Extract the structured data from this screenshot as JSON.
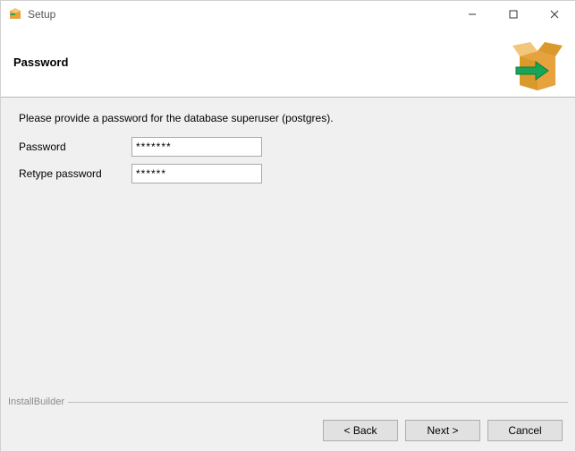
{
  "titlebar": {
    "title": "Setup"
  },
  "header": {
    "page_title": "Password"
  },
  "body": {
    "description": "Please provide a password for the database superuser (postgres).",
    "fields": {
      "password_label": "Password",
      "password_value": "*******",
      "retype_label": "Retype password",
      "retype_value": "******"
    },
    "branding": "InstallBuilder"
  },
  "footer": {
    "back": "< Back",
    "next": "Next >",
    "cancel": "Cancel"
  }
}
